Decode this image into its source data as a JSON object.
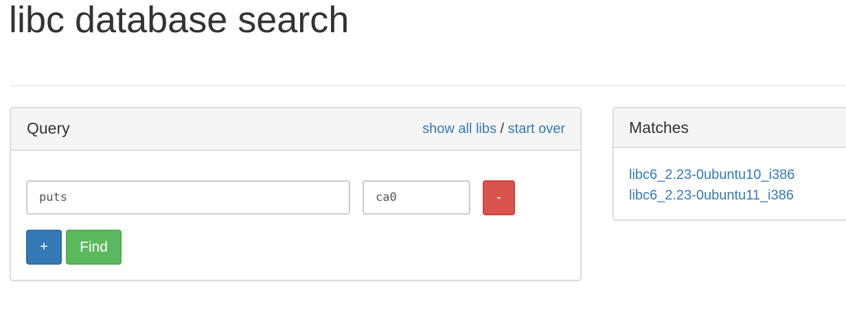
{
  "page": {
    "title": "libc database search"
  },
  "query_panel": {
    "title": "Query",
    "show_all_libs": "show all libs",
    "separator": "/",
    "start_over": "start over",
    "symbol_value": "puts",
    "address_value": "ca0",
    "remove_label": "-",
    "add_label": "+",
    "find_label": "Find"
  },
  "matches_panel": {
    "title": "Matches",
    "items": [
      "libc6_2.23-0ubuntu10_i386",
      "libc6_2.23-0ubuntu11_i386"
    ]
  },
  "colors": {
    "link": "#337ab7",
    "danger": "#d9534f",
    "primary": "#337ab7",
    "success": "#5cb85c"
  }
}
